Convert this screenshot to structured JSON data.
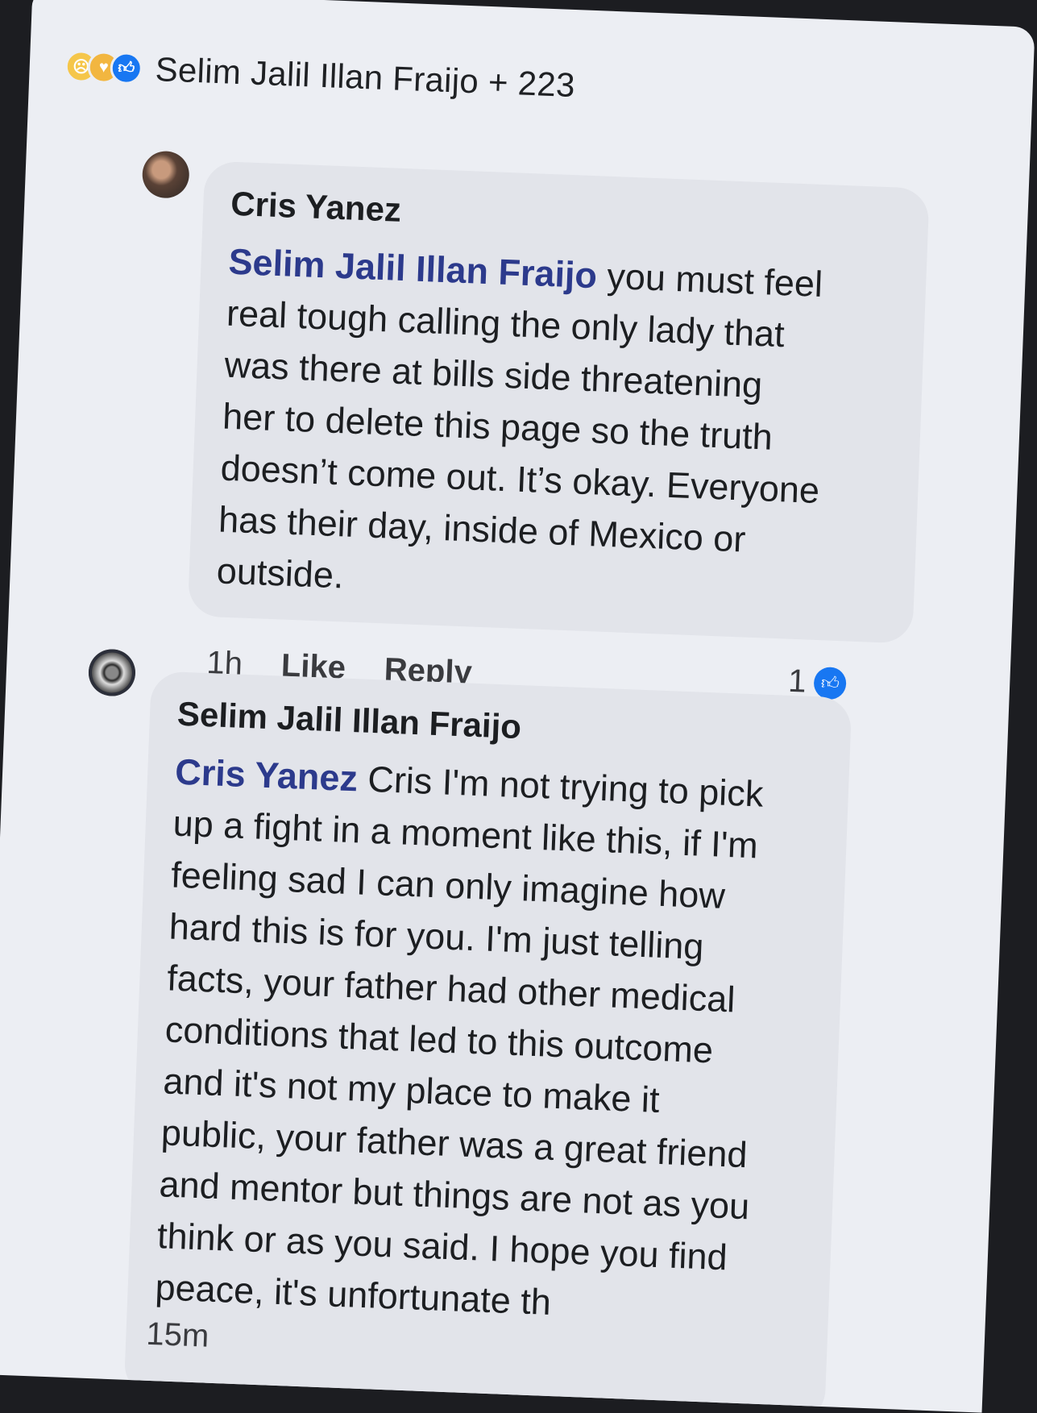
{
  "reactions": {
    "icons": [
      "sad-reaction-icon",
      "care-reaction-icon",
      "like-reaction-icon"
    ],
    "summary": "Selim Jalil Illan Fraijo + 223"
  },
  "comments": [
    {
      "author": "Cris Yanez",
      "mention": "Selim Jalil Illan Fraijo",
      "text_lines": [
        " you must feel",
        "real tough calling the only lady that",
        "was there at bills side threatening",
        "her to delete this page so the truth",
        "doesn’t come out. It’s okay. Everyone",
        "has their day, inside of Mexico or",
        "outside."
      ],
      "time": "1h",
      "like_label": "Like",
      "reply_label": "Reply",
      "like_count": "1"
    },
    {
      "author": "Selim Jalil Illan Fraijo",
      "mention": "Cris Yanez",
      "text_lines": [
        " Cris I'm not trying to pick",
        "up a fight in a moment like this, if I'm",
        "feeling sad I can only imagine how",
        "hard this is for you. I'm just telling",
        "facts, your father had other medical",
        "conditions that led to this outcome",
        "and it's not my place to make it",
        "public, your father was a great friend",
        "and mentor but things are not as you",
        "think or as you said. I hope you find",
        "peace, it's unfortunate th"
      ],
      "time": "15m"
    }
  ],
  "colors": {
    "accent": "#1877f2",
    "mention": "#2c3a8c",
    "bubble": "#e2e4ea",
    "screen": "#eceef3"
  }
}
